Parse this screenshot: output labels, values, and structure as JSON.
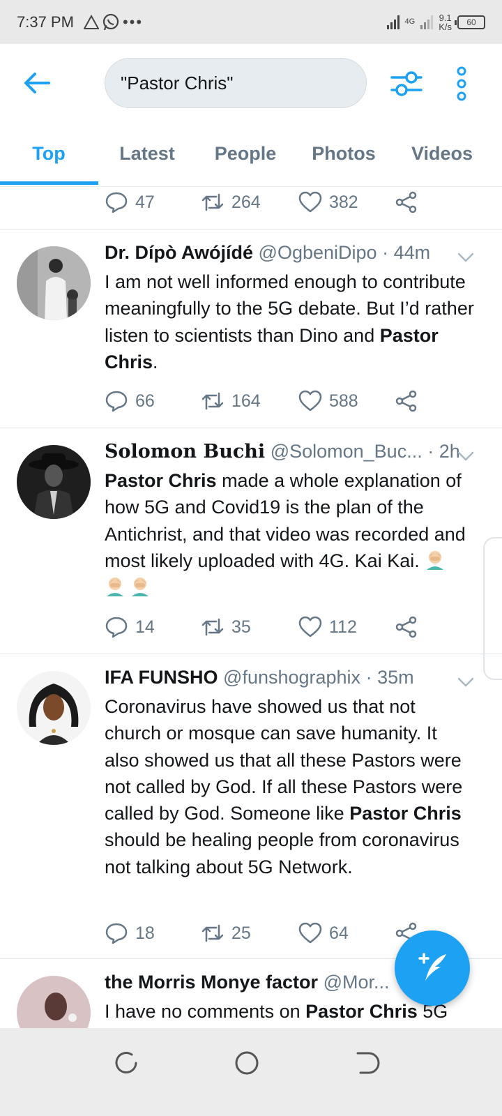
{
  "status_bar": {
    "time": "7:37 PM",
    "network": "4G",
    "speed_value": "9.1",
    "speed_unit": "K/s",
    "battery": "60"
  },
  "header": {
    "search_value": "\"Pastor Chris\""
  },
  "tabs": [
    {
      "label": "Top",
      "active": true
    },
    {
      "label": "Latest",
      "active": false
    },
    {
      "label": "People",
      "active": false
    },
    {
      "label": "Photos",
      "active": false
    },
    {
      "label": "Videos",
      "active": false
    }
  ],
  "partial_tweet": {
    "replies": "47",
    "retweets": "264",
    "likes": "382"
  },
  "tweets": [
    {
      "name": "Dr. Dípò Awójídé",
      "handle": "@OgbeniDipo",
      "sep": " · ",
      "time": "44m",
      "text_pre": "I am not well informed enough to contribute meaningfully to the 5G debate. But I’d rather listen to scientists than Dino and ",
      "text_bold": "Pastor Chris",
      "text_post": ".",
      "replies": "66",
      "retweets": "164",
      "likes": "588"
    },
    {
      "name": "Solomon Buchi",
      "handle": "@Solomon_Buc...",
      "sep": " · ",
      "time": "2h",
      "text_bold": "Pastor Chris",
      "text_post": " made a whole explanation of how 5G and Covid19 is the plan of the Antichrist, and that video was recorded and most likely uploaded with 4G. Kai Kai. ",
      "emoji_name": "face-palm-emoji",
      "replies": "14",
      "retweets": "35",
      "likes": "112"
    },
    {
      "name": "IFA FUNSHO",
      "handle": "@funshographix",
      "sep": " · ",
      "time": "35m",
      "text_pre": "Coronavirus have showed us that not church or mosque can save humanity. It also showed us that all these Pastors were not called by God. If all these Pastors were called by God. Someone like ",
      "text_bold": "Pastor Chris",
      "text_post": " should be healing people from coronavirus not talking about 5G Network.",
      "replies": "18",
      "retweets": "25",
      "likes": "64"
    },
    {
      "name": "the Morris Monye factor",
      "handle": "@Mor...",
      "text_pre": "I have no comments on ",
      "text_bold": "Pastor Chris",
      "text_post": " 5G"
    }
  ],
  "colors": {
    "accent": "#1da1f2",
    "secondary_text": "#657786",
    "divider": "#dfe4e8"
  },
  "icons": [
    "back-arrow-icon",
    "filter-sliders-icon",
    "more-vertical-icon",
    "reply-icon",
    "retweet-icon",
    "like-heart-icon",
    "share-icon",
    "chevron-down-icon",
    "compose-tweet-icon"
  ]
}
